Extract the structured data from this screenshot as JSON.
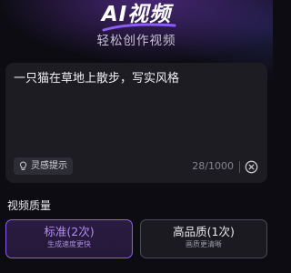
{
  "header": {
    "title": "AI视频",
    "subtitle": "轻松创作视频"
  },
  "prompt": {
    "text": "一只猫在草地上散步，写实风格",
    "inspiration_label": "灵感提示",
    "inspiration_icon": "lightbulb-icon",
    "counter": "28/1000",
    "clear_icon": "close-circle-icon"
  },
  "quality": {
    "title": "视频质量",
    "options": [
      {
        "name": "标准(2次)",
        "description": "生成速度更快",
        "selected": true
      },
      {
        "name": "高品质(1次)",
        "description": "画质更清晰",
        "selected": false
      }
    ]
  },
  "colors": {
    "accent": "#8b5cf6",
    "accent_text": "#b48cfa",
    "card_bg": "#1c1c22",
    "page_bg": "#0c0c12"
  }
}
